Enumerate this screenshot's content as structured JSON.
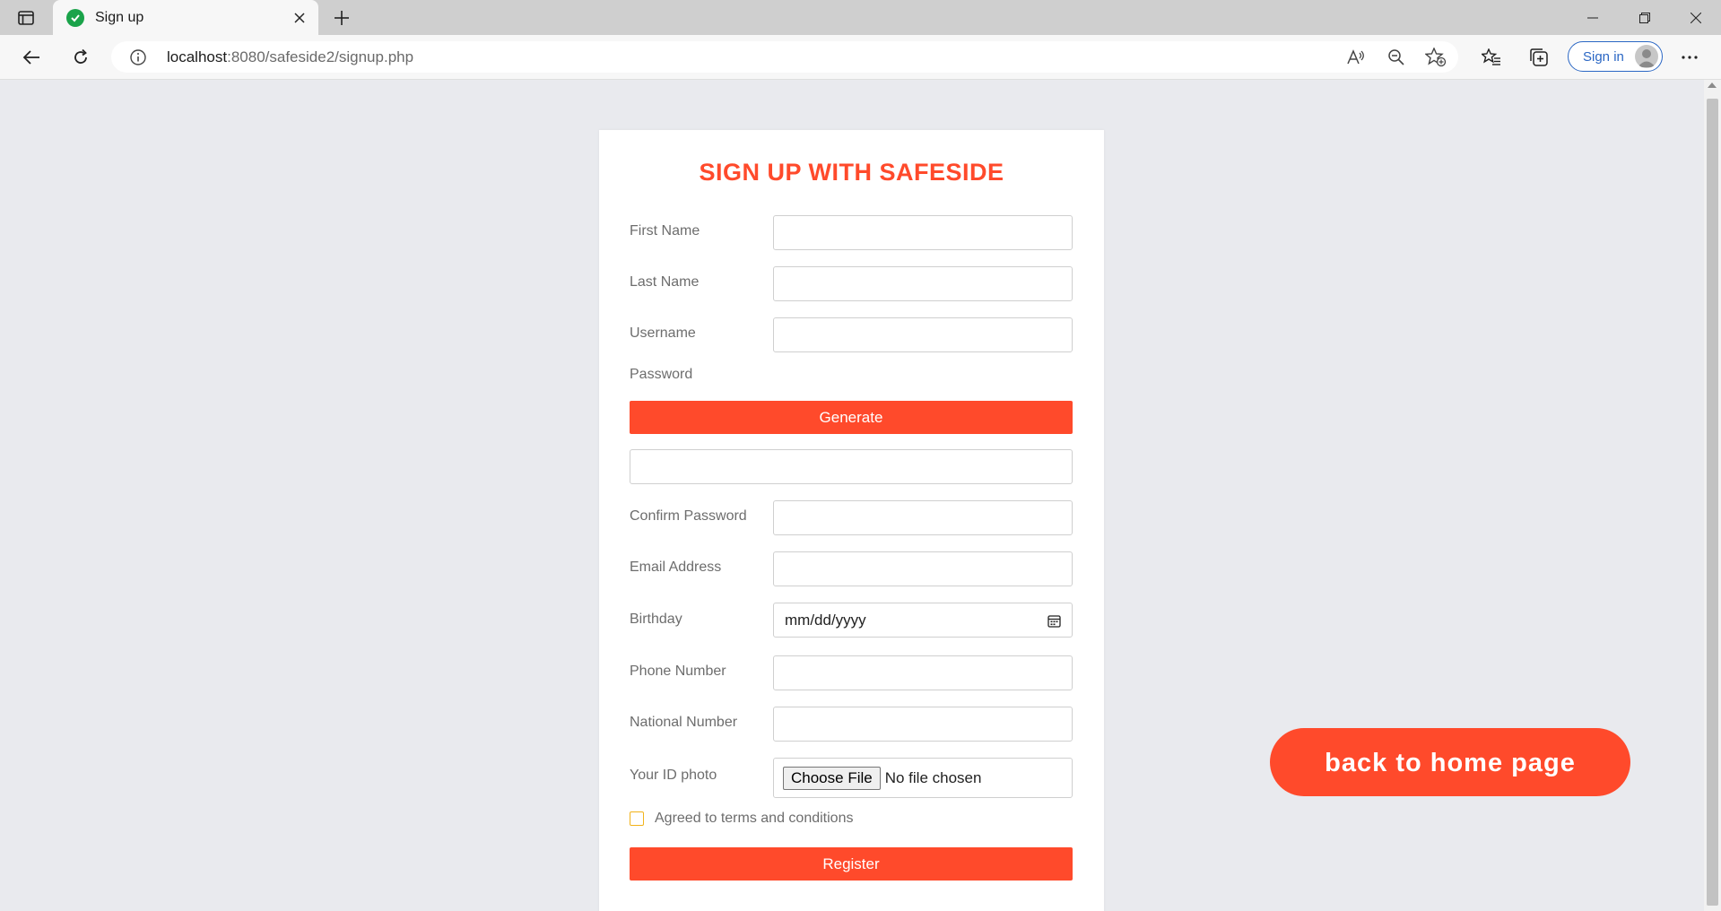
{
  "browser": {
    "tab_title": "Sign up",
    "url_host": "localhost",
    "url_path": ":8080/safeside2/signup.php",
    "sign_in_label": "Sign in"
  },
  "form": {
    "title": "SIGN UP WITH SAFESIDE",
    "first_name_label": "First Name",
    "last_name_label": "Last Name",
    "username_label": "Username",
    "password_label": "Password",
    "generate_label": "Generate",
    "confirm_password_label": "Confirm Password",
    "email_label": "Email Address",
    "birthday_label": "Birthday",
    "birthday_placeholder": "mm/dd/yyyy",
    "phone_label": "Phone Number",
    "national_number_label": "National Number",
    "id_photo_label": "Your ID photo",
    "choose_file_label": "Choose File",
    "no_file_text": "No file chosen",
    "terms_label": "Agreed to terms and conditions",
    "register_label": "Register"
  },
  "home_button_label": "back to home page",
  "colors": {
    "accent": "#ff4a2b",
    "page_background": "#e9eaee",
    "checkbox_border": "#f2b31a",
    "link_blue": "#2b67c4"
  }
}
